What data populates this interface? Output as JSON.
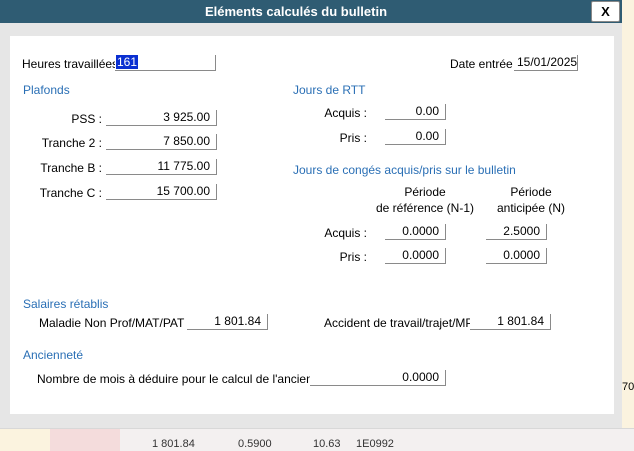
{
  "window": {
    "title": "Eléments calculés du bulletin",
    "close_label": "X"
  },
  "heures": {
    "label": "Heures travaillées :",
    "value": "161"
  },
  "date_entree": {
    "label": "Date entrée :",
    "value": "15/01/2025"
  },
  "plafonds": {
    "title": "Plafonds",
    "rows": [
      {
        "label": "PSS :",
        "value": "3 925.00"
      },
      {
        "label": "Tranche 2 :",
        "value": "7 850.00"
      },
      {
        "label": "Tranche B :",
        "value": "11 775.00"
      },
      {
        "label": "Tranche C :",
        "value": "15 700.00"
      }
    ]
  },
  "rtt": {
    "title": "Jours de RTT",
    "acquis_label": "Acquis :",
    "acquis_value": "0.00",
    "pris_label": "Pris :",
    "pris_value": "0.00"
  },
  "conges": {
    "title": "Jours de congés acquis/pris sur le bulletin",
    "col1_line1": "Période",
    "col1_line2": "de référence (N-1)",
    "col2_line1": "Période",
    "col2_line2": "anticipée (N)",
    "acquis_label": "Acquis :",
    "acquis_ref": "0.0000",
    "acquis_ant": "2.5000",
    "pris_label": "Pris :",
    "pris_ref": "0.0000",
    "pris_ant": "0.0000"
  },
  "salaires": {
    "title": "Salaires rétablis",
    "maladie_label": "Maladie Non Prof/MAT/PAT :",
    "maladie_value": "1 801.84",
    "accident_label": "Accident de travail/trajet/MP :",
    "accident_value": "1 801.84"
  },
  "anciennete": {
    "title": "Ancienneté",
    "label": "Nombre de mois à déduire pour le calcul de l'ancienneté :",
    "value": "0.0000"
  },
  "background": {
    "right_value": "70",
    "bottom_cells": [
      "1 801.84",
      "0.5900",
      "10.63",
      "1E0992"
    ]
  }
}
